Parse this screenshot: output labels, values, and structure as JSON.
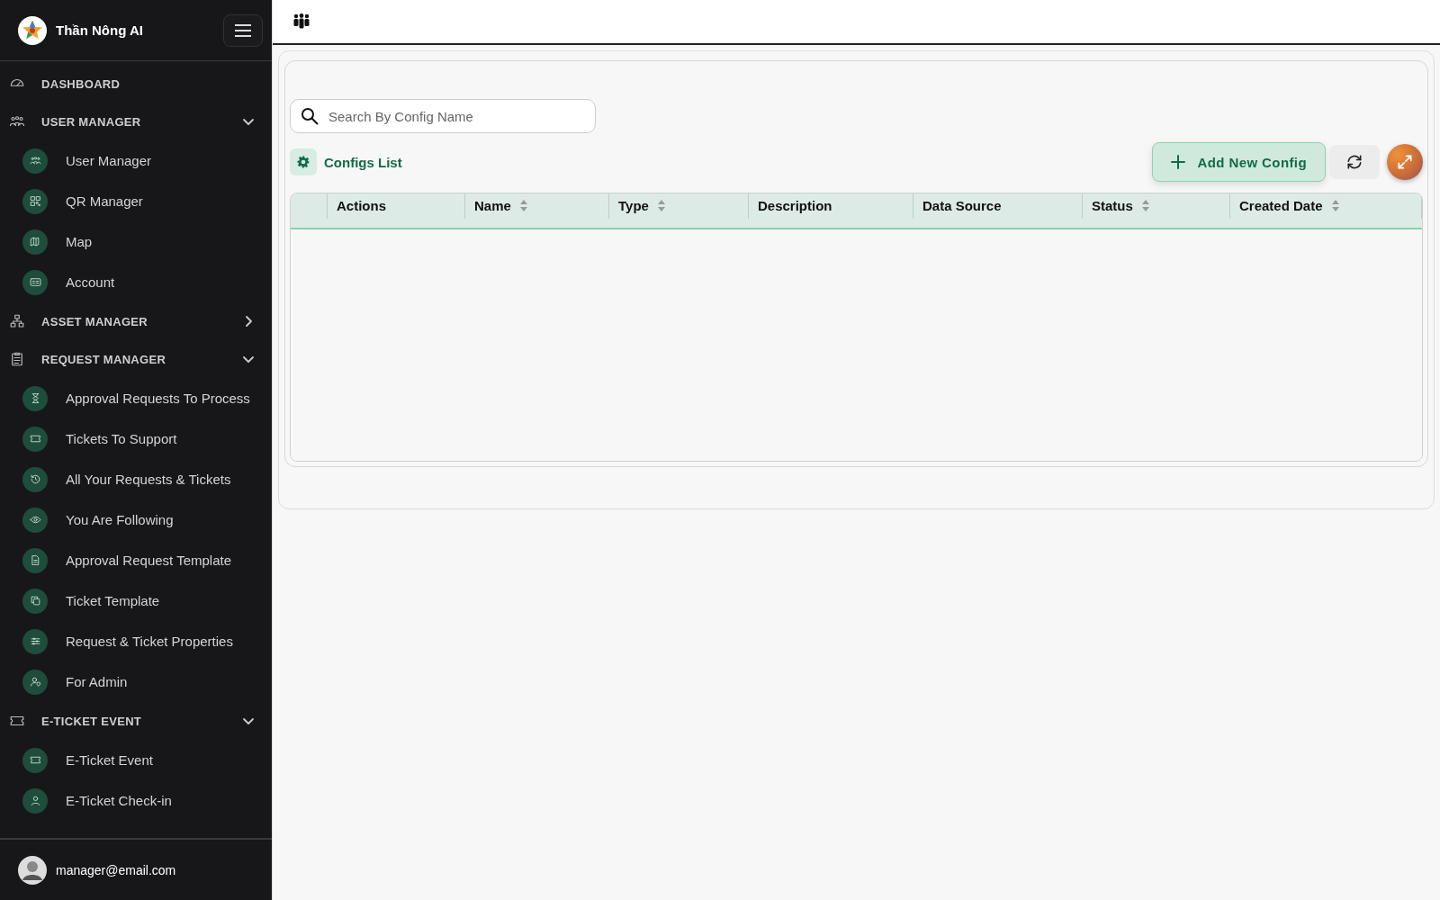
{
  "app": {
    "name": "Thần Nông AI"
  },
  "sidebar": {
    "items": [
      {
        "label": "DASHBOARD"
      },
      {
        "label": "USER MANAGER",
        "expanded": true,
        "children": [
          {
            "label": "User Manager"
          },
          {
            "label": "QR Manager"
          },
          {
            "label": "Map"
          },
          {
            "label": "Account"
          }
        ]
      },
      {
        "label": "ASSET MANAGER",
        "expanded": false
      },
      {
        "label": "REQUEST MANAGER",
        "expanded": true,
        "children": [
          {
            "label": "Approval Requests To Process"
          },
          {
            "label": "Tickets To Support"
          },
          {
            "label": "All Your Requests & Tickets"
          },
          {
            "label": "You Are Following"
          },
          {
            "label": "Approval Request Template"
          },
          {
            "label": "Ticket Template"
          },
          {
            "label": "Request & Ticket Properties"
          },
          {
            "label": "For Admin"
          }
        ]
      },
      {
        "label": "E-TICKET EVENT",
        "expanded": true,
        "children": [
          {
            "label": "E-Ticket Event"
          },
          {
            "label": "E-Ticket Check-in"
          }
        ]
      }
    ],
    "user": {
      "email": "manager@email.com"
    }
  },
  "search": {
    "placeholder": "Search By Config Name"
  },
  "list": {
    "title": "Configs List",
    "add_button": "Add New Config"
  },
  "table": {
    "columns": [
      {
        "label": "Actions",
        "sortable": false
      },
      {
        "label": "Name",
        "sortable": true
      },
      {
        "label": "Type",
        "sortable": true
      },
      {
        "label": "Description",
        "sortable": false
      },
      {
        "label": "Data Source",
        "sortable": false
      },
      {
        "label": "Status",
        "sortable": true
      },
      {
        "label": "Created Date",
        "sortable": true
      }
    ]
  }
}
